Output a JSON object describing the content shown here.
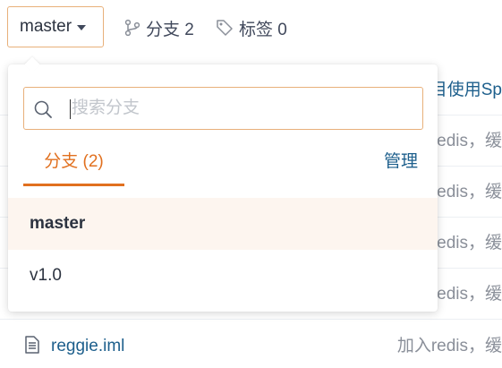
{
  "branch_selector": {
    "current": "master"
  },
  "repo_meta": {
    "branches_label": "分支 2",
    "tags_label": "标签 0"
  },
  "dropdown": {
    "search_placeholder": "搜索分支",
    "tab_label": "分支 (2)",
    "manage_label": "管理",
    "branches": [
      {
        "name": "master",
        "active": true
      },
      {
        "name": "v1.0",
        "active": false
      }
    ]
  },
  "file_list": {
    "commit_snippets": [
      "目使用Sp",
      "redis，缓",
      "redis，缓",
      "redis，缓",
      "redis，缓"
    ],
    "file": {
      "name": "reggie.iml",
      "commit": "加入redis，缓"
    }
  },
  "colors": {
    "accent": "#e1701f",
    "link": "#1d5f8c",
    "active_row_bg": "#fdf5ef",
    "input_border": "#e8b07a"
  },
  "icons": [
    "chevron-down-icon",
    "branch-icon",
    "tag-icon",
    "search-icon",
    "file-icon"
  ]
}
